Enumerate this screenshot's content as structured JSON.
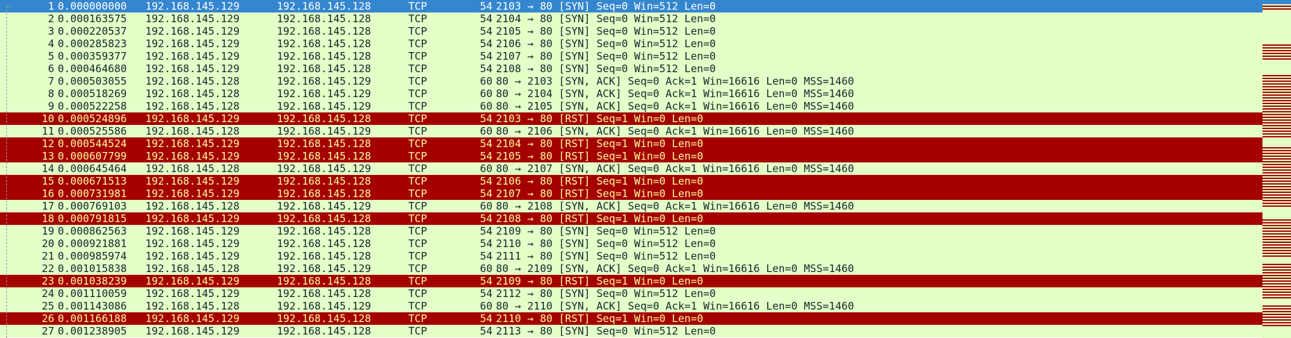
{
  "packets": [
    {
      "no": "1",
      "time": "0.000000000",
      "src": "192.168.145.129",
      "dst": "192.168.145.128",
      "proto": "TCP",
      "len": "54",
      "info": "2103 → 80 [SYN] Seq=0 Win=512 Len=0",
      "kind": "selected"
    },
    {
      "no": "2",
      "time": "0.000163575",
      "src": "192.168.145.129",
      "dst": "192.168.145.128",
      "proto": "TCP",
      "len": "54",
      "info": "2104 → 80 [SYN] Seq=0 Win=512 Len=0",
      "kind": "normal"
    },
    {
      "no": "3",
      "time": "0.000220537",
      "src": "192.168.145.129",
      "dst": "192.168.145.128",
      "proto": "TCP",
      "len": "54",
      "info": "2105 → 80 [SYN] Seq=0 Win=512 Len=0",
      "kind": "normal"
    },
    {
      "no": "4",
      "time": "0.000285823",
      "src": "192.168.145.129",
      "dst": "192.168.145.128",
      "proto": "TCP",
      "len": "54",
      "info": "2106 → 80 [SYN] Seq=0 Win=512 Len=0",
      "kind": "normal"
    },
    {
      "no": "5",
      "time": "0.000359377",
      "src": "192.168.145.129",
      "dst": "192.168.145.128",
      "proto": "TCP",
      "len": "54",
      "info": "2107 → 80 [SYN] Seq=0 Win=512 Len=0",
      "kind": "normal"
    },
    {
      "no": "6",
      "time": "0.000464680",
      "src": "192.168.145.129",
      "dst": "192.168.145.128",
      "proto": "TCP",
      "len": "54",
      "info": "2108 → 80 [SYN] Seq=0 Win=512 Len=0",
      "kind": "normal"
    },
    {
      "no": "7",
      "time": "0.000503055",
      "src": "192.168.145.128",
      "dst": "192.168.145.129",
      "proto": "TCP",
      "len": "60",
      "info": "80 → 2103 [SYN, ACK] Seq=0 Ack=1 Win=16616 Len=0 MSS=1460",
      "kind": "normal"
    },
    {
      "no": "8",
      "time": "0.000518269",
      "src": "192.168.145.128",
      "dst": "192.168.145.129",
      "proto": "TCP",
      "len": "60",
      "info": "80 → 2104 [SYN, ACK] Seq=0 Ack=1 Win=16616 Len=0 MSS=1460",
      "kind": "normal"
    },
    {
      "no": "9",
      "time": "0.000522258",
      "src": "192.168.145.128",
      "dst": "192.168.145.129",
      "proto": "TCP",
      "len": "60",
      "info": "80 → 2105 [SYN, ACK] Seq=0 Ack=1 Win=16616 Len=0 MSS=1460",
      "kind": "normal"
    },
    {
      "no": "10",
      "time": "0.000524896",
      "src": "192.168.145.129",
      "dst": "192.168.145.128",
      "proto": "TCP",
      "len": "54",
      "info": "2103 → 80 [RST] Seq=1 Win=0 Len=0",
      "kind": "rst"
    },
    {
      "no": "11",
      "time": "0.000525586",
      "src": "192.168.145.128",
      "dst": "192.168.145.129",
      "proto": "TCP",
      "len": "60",
      "info": "80 → 2106 [SYN, ACK] Seq=0 Ack=1 Win=16616 Len=0 MSS=1460",
      "kind": "normal"
    },
    {
      "no": "12",
      "time": "0.000544524",
      "src": "192.168.145.129",
      "dst": "192.168.145.128",
      "proto": "TCP",
      "len": "54",
      "info": "2104 → 80 [RST] Seq=1 Win=0 Len=0",
      "kind": "rst"
    },
    {
      "no": "13",
      "time": "0.000607799",
      "src": "192.168.145.129",
      "dst": "192.168.145.128",
      "proto": "TCP",
      "len": "54",
      "info": "2105 → 80 [RST] Seq=1 Win=0 Len=0",
      "kind": "rst"
    },
    {
      "no": "14",
      "time": "0.000645464",
      "src": "192.168.145.128",
      "dst": "192.168.145.129",
      "proto": "TCP",
      "len": "60",
      "info": "80 → 2107 [SYN, ACK] Seq=0 Ack=1 Win=16616 Len=0 MSS=1460",
      "kind": "normal"
    },
    {
      "no": "15",
      "time": "0.000671513",
      "src": "192.168.145.129",
      "dst": "192.168.145.128",
      "proto": "TCP",
      "len": "54",
      "info": "2106 → 80 [RST] Seq=1 Win=0 Len=0",
      "kind": "rst"
    },
    {
      "no": "16",
      "time": "0.000731981",
      "src": "192.168.145.129",
      "dst": "192.168.145.128",
      "proto": "TCP",
      "len": "54",
      "info": "2107 → 80 [RST] Seq=1 Win=0 Len=0",
      "kind": "rst"
    },
    {
      "no": "17",
      "time": "0.000769103",
      "src": "192.168.145.128",
      "dst": "192.168.145.129",
      "proto": "TCP",
      "len": "60",
      "info": "80 → 2108 [SYN, ACK] Seq=0 Ack=1 Win=16616 Len=0 MSS=1460",
      "kind": "normal"
    },
    {
      "no": "18",
      "time": "0.000791815",
      "src": "192.168.145.129",
      "dst": "192.168.145.128",
      "proto": "TCP",
      "len": "54",
      "info": "2108 → 80 [RST] Seq=1 Win=0 Len=0",
      "kind": "rst"
    },
    {
      "no": "19",
      "time": "0.000862563",
      "src": "192.168.145.129",
      "dst": "192.168.145.128",
      "proto": "TCP",
      "len": "54",
      "info": "2109 → 80 [SYN] Seq=0 Win=512 Len=0",
      "kind": "normal"
    },
    {
      "no": "20",
      "time": "0.000921881",
      "src": "192.168.145.129",
      "dst": "192.168.145.128",
      "proto": "TCP",
      "len": "54",
      "info": "2110 → 80 [SYN] Seq=0 Win=512 Len=0",
      "kind": "normal"
    },
    {
      "no": "21",
      "time": "0.000985974",
      "src": "192.168.145.129",
      "dst": "192.168.145.128",
      "proto": "TCP",
      "len": "54",
      "info": "2111 → 80 [SYN] Seq=0 Win=512 Len=0",
      "kind": "normal"
    },
    {
      "no": "22",
      "time": "0.001015838",
      "src": "192.168.145.128",
      "dst": "192.168.145.129",
      "proto": "TCP",
      "len": "60",
      "info": "80 → 2109 [SYN, ACK] Seq=0 Ack=1 Win=16616 Len=0 MSS=1460",
      "kind": "normal"
    },
    {
      "no": "23",
      "time": "0.001038239",
      "src": "192.168.145.129",
      "dst": "192.168.145.128",
      "proto": "TCP",
      "len": "54",
      "info": "2109 → 80 [RST] Seq=1 Win=0 Len=0",
      "kind": "rst"
    },
    {
      "no": "24",
      "time": "0.001110059",
      "src": "192.168.145.129",
      "dst": "192.168.145.128",
      "proto": "TCP",
      "len": "54",
      "info": "2112 → 80 [SYN] Seq=0 Win=512 Len=0",
      "kind": "normal"
    },
    {
      "no": "25",
      "time": "0.001143086",
      "src": "192.168.145.128",
      "dst": "192.168.145.129",
      "proto": "TCP",
      "len": "60",
      "info": "80 → 2110 [SYN, ACK] Seq=0 Ack=1 Win=16616 Len=0 MSS=1460",
      "kind": "normal"
    },
    {
      "no": "26",
      "time": "0.001166188",
      "src": "192.168.145.129",
      "dst": "192.168.145.128",
      "proto": "TCP",
      "len": "54",
      "info": "2110 → 80 [RST] Seq=1 Win=0 Len=0",
      "kind": "rst"
    },
    {
      "no": "27",
      "time": "0.001238905",
      "src": "192.168.145.129",
      "dst": "192.168.145.128",
      "proto": "TCP",
      "len": "54",
      "info": "2113 → 80 [SYN] Seq=0 Win=512 Len=0",
      "kind": "normal"
    }
  ],
  "colors": {
    "normal_bg": "#e4ffc7",
    "normal_fg": "#12272e",
    "rst_bg": "#a40000",
    "rst_fg": "#fffc9c",
    "selected_bg": "#3486cf",
    "selected_fg": "#ffffff"
  }
}
